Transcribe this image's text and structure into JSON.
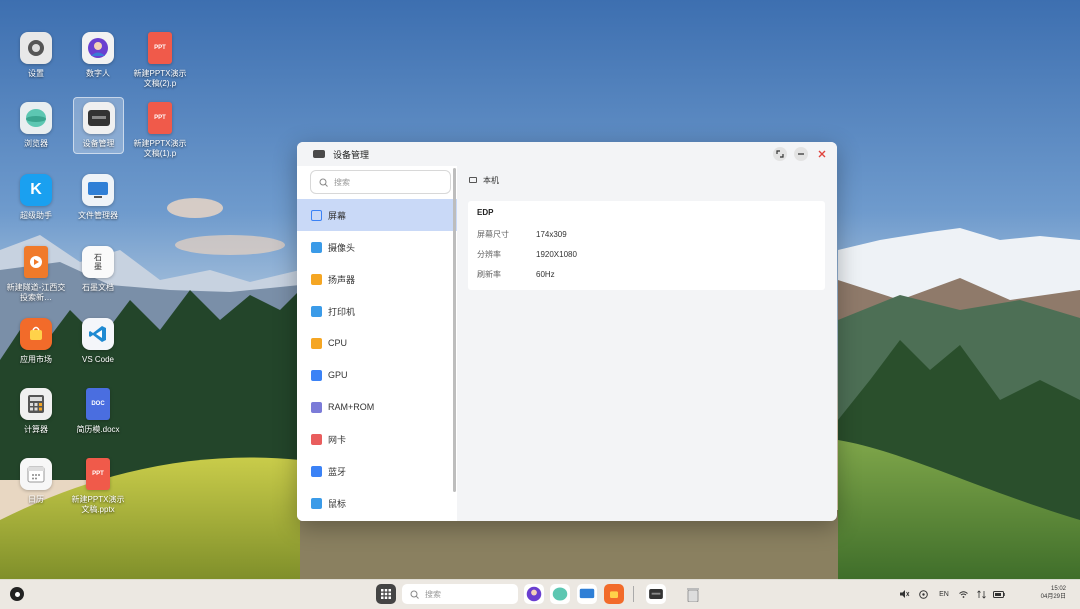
{
  "desktop": {
    "icons": [
      {
        "label": "设置",
        "icon": "settings-icon"
      },
      {
        "label": "数字人",
        "icon": "digital-human-icon"
      },
      {
        "label": "新建PPTX演示文稿(2).p",
        "icon": "ppt-file-icon",
        "badge": "PPT"
      },
      {
        "label": "浏览器",
        "icon": "browser-icon"
      },
      {
        "label": "设备管理",
        "icon": "device-manager-icon"
      },
      {
        "label": "新建PPTX演示文稿(1).p",
        "icon": "ppt-file-icon",
        "badge": "PPT"
      },
      {
        "label": "超级助手",
        "icon": "assistant-icon"
      },
      {
        "label": "文件管理器",
        "icon": "file-manager-icon"
      },
      {
        "label": "新建隧道-江西交投索新…",
        "icon": "video-file-icon"
      },
      {
        "label": "石墨文档",
        "icon": "shimo-docs-icon",
        "glyph": "石墨"
      },
      {
        "label": "应用市场",
        "icon": "app-store-icon"
      },
      {
        "label": "VS Code",
        "icon": "vscode-icon"
      },
      {
        "label": "计算器",
        "icon": "calculator-icon"
      },
      {
        "label": "简历模.docx",
        "icon": "doc-file-icon",
        "badge": "DOC"
      },
      {
        "label": "日历",
        "icon": "calendar-icon"
      },
      {
        "label": "新建PPTX演示文稿.pptx",
        "icon": "ppt-file-icon",
        "badge": "PPT"
      }
    ]
  },
  "window": {
    "title": "设备管理",
    "search_placeholder": "搜索",
    "nav": [
      {
        "label": "屏幕",
        "icon": "screen-icon",
        "color": "#3b82f6",
        "active": true
      },
      {
        "label": "摄像头",
        "icon": "camera-icon",
        "color": "#3b9be8"
      },
      {
        "label": "扬声器",
        "icon": "speaker-icon",
        "color": "#f5a623"
      },
      {
        "label": "打印机",
        "icon": "printer-icon",
        "color": "#3b9be8"
      },
      {
        "label": "CPU",
        "icon": "cpu-icon",
        "color": "#f5a623"
      },
      {
        "label": "GPU",
        "icon": "gpu-icon",
        "color": "#3b82f6"
      },
      {
        "label": "RAM+ROM",
        "icon": "memory-icon",
        "color": "#7b7bd8"
      },
      {
        "label": "网卡",
        "icon": "network-card-icon",
        "color": "#e95d5d"
      },
      {
        "label": "蓝牙",
        "icon": "bluetooth-icon",
        "color": "#3b82f6"
      },
      {
        "label": "鼠标",
        "icon": "mouse-icon",
        "color": "#3b9be8"
      }
    ],
    "breadcrumb": "本机",
    "card": {
      "title": "EDP",
      "rows": [
        {
          "key": "屏幕尺寸",
          "value": "174x309"
        },
        {
          "key": "分辨率",
          "value": "1920X1080"
        },
        {
          "key": "刷新率",
          "value": "60Hz"
        }
      ]
    }
  },
  "taskbar": {
    "search_placeholder": "搜索",
    "tray": {
      "lang": "EN"
    },
    "clock": {
      "time": "15:02",
      "date": "04月29日"
    }
  },
  "colors": {
    "accent": "#c9d9f7",
    "close": "#e0443e"
  }
}
